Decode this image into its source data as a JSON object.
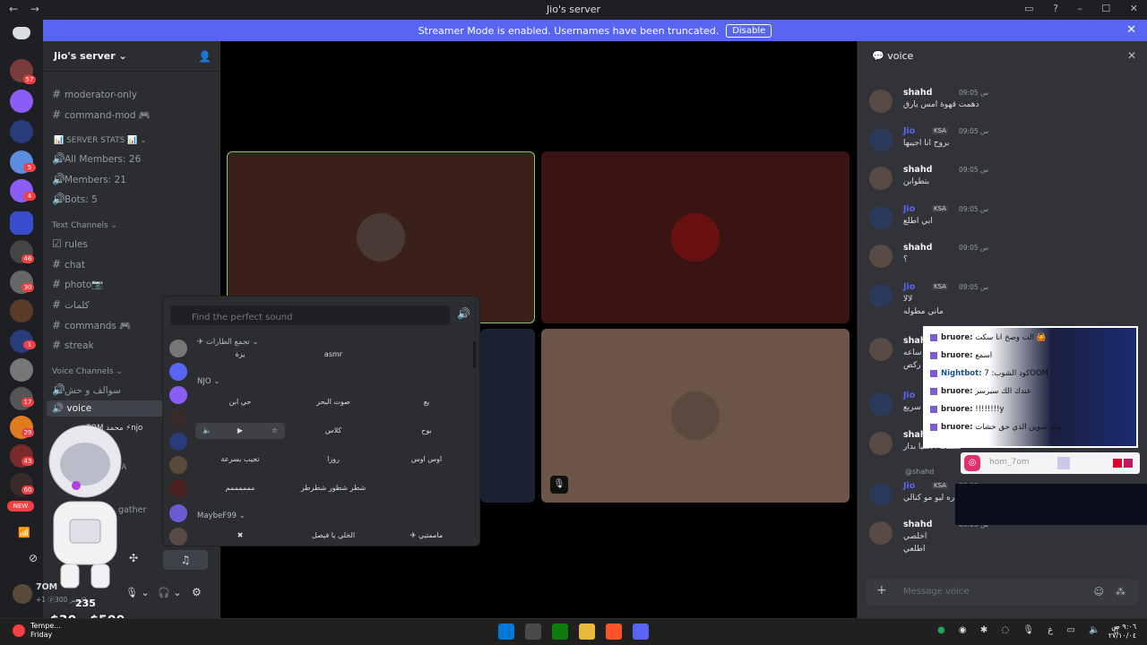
{
  "window": {
    "title": "Jio's server",
    "nav_back": "←",
    "nav_forward": "→"
  },
  "banner": {
    "text": "Streamer Mode is enabled. Usernames have been truncated.",
    "disable_label": "Disable",
    "close": "✕"
  },
  "rail": {
    "badges": [
      "57",
      "5",
      "4",
      "46",
      "30",
      "1",
      "17",
      "29",
      "43",
      "60"
    ],
    "new_label": "NEW"
  },
  "sidebar": {
    "server_name": "Jio's server ⌄",
    "channels_top": [
      "moderator-only",
      "command-mod 🎮"
    ],
    "stats_category": "📊 SERVER STATS 📊 ⌄",
    "stats": [
      "All Members: 26",
      "Members: 21",
      "Bots: 5"
    ],
    "text_category": "Text Channels ⌄",
    "text_channels": [
      "rules",
      "chat",
      "photo📷",
      "كلمات",
      "commands 🎮",
      "streak"
    ],
    "voice_category": "Voice Channels ⌄",
    "voice_channels": [
      "سوالف و حش",
      "voice"
    ],
    "voice_user": "7OM محمد ⚡njo",
    "voice_user2": "SA",
    "gather": "gather",
    "user_name": "7OM",
    "user_status": "+1 ⓟ300 اكسبر..."
  },
  "soundboard": {
    "search_placeholder": "Find the perfect sound",
    "groups": [
      "✈ تجمع الطارات ⌄",
      "NJO ⌄",
      "MaybeF99 ⌄"
    ],
    "sounds_row0": [
      "يزة",
      "asmr"
    ],
    "sounds_row1": [
      "حي ابن",
      "صوت البحر",
      "يع"
    ],
    "sounds_row2": [
      "",
      "كلاس",
      "بوح"
    ],
    "sounds_row3": [
      "تجيب بسرعة",
      "روزا",
      "اوس اوس"
    ],
    "sounds_row4": [
      "ممممممم",
      "شطر شطور شطرطر",
      ""
    ],
    "sounds_row5": [
      "",
      "الخلي يا فيصل",
      "✈ ماممتيي"
    ]
  },
  "chat": {
    "channel": "voice",
    "close": "✕",
    "messages": [
      {
        "name": "shahd",
        "tag": "",
        "time": "س 09:05",
        "text": "دهمت قهوة امس يارق",
        "text2": ""
      },
      {
        "name": "Jio",
        "tag": "KSA",
        "time": "س 09:05",
        "text": "بروح انا اجيبها",
        "text2": ""
      },
      {
        "name": "shahd",
        "tag": "",
        "time": "س 09:05",
        "text": "بتطوابن",
        "text2": ""
      },
      {
        "name": "Jio",
        "tag": "KSA",
        "time": "س 09:05",
        "text": "ابي اطلع",
        "text2": ""
      },
      {
        "name": "shahd",
        "tag": "",
        "time": "س 09:05",
        "text": "؟",
        "text2": ""
      },
      {
        "name": "Jio",
        "tag": "KSA",
        "time": "س 09:05",
        "text": "لالا",
        "text2": "ماني مطوله"
      },
      {
        "name": "shahd",
        "tag": "",
        "time": "",
        "text": "ساعه",
        "text2": "ركض"
      },
      {
        "name": "Jio",
        "tag": "",
        "time": "",
        "text": "سريع",
        "text2": ""
      },
      {
        "name": "shahd",
        "tag": "",
        "time": "",
        "text": "خطفت الاشيا بدار",
        "text2": ""
      },
      {
        "name": "Jio",
        "tag": "KSA",
        "time": "س 09:05",
        "text": "اره ليو مو كنالي",
        "text2": ""
      },
      {
        "name": "shahd",
        "tag": "",
        "time": "س 09:05",
        "text": "اخلصي",
        "text2": "اطلعي"
      }
    ],
    "reply_to": "@shahd",
    "composer_placeholder": "Message voice"
  },
  "overlay": {
    "lines": [
      {
        "user": "bruore:",
        "text": "الت وصخ انا سكت 🙆"
      },
      {
        "user": "bruore:",
        "text": "اسمع"
      },
      {
        "user": "Nightbot:",
        "text": "كود الشوب: 7OOM"
      },
      {
        "user": "bruore:",
        "text": "عندك الك سيرسر"
      },
      {
        "user": "bruore:",
        "text": "!!!!!!!!y"
      },
      {
        "user": "bruore:",
        "text": "يولد سوين الذي حق خشات"
      }
    ],
    "ig_handle": "hom_7om",
    "prices": "$30 · $500",
    "num": "235"
  },
  "taskbar": {
    "weather_line1": "Tempe...",
    "weather_line2": "Friday",
    "time": "٩:٠٦ ص",
    "date": "٢٧/١٠/٠٤",
    "lang": "ع"
  },
  "colors": {
    "brand": "#5865f2",
    "danger": "#f23f43",
    "online": "#23a55a"
  }
}
